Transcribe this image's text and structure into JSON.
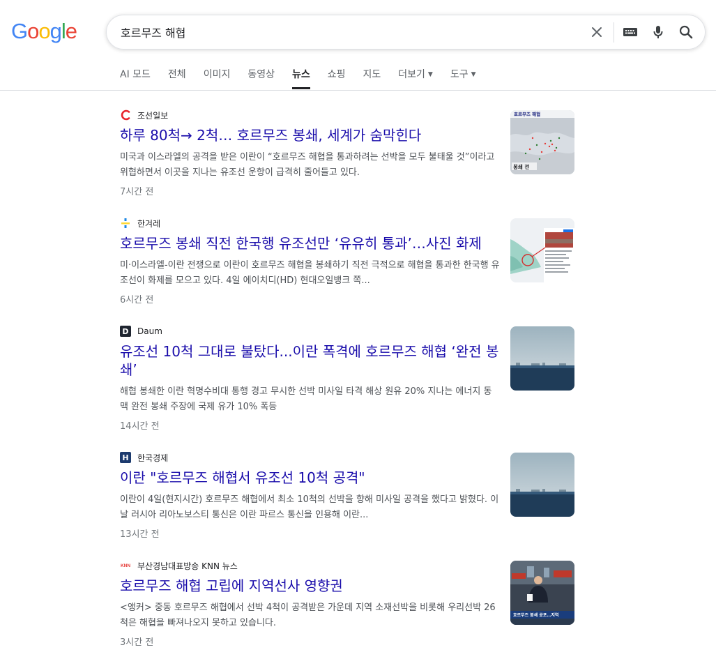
{
  "logo": {
    "g1": "G",
    "o1": "o",
    "o2": "o",
    "g2": "g",
    "l": "l",
    "e": "e"
  },
  "search": {
    "query": "호르무즈 해협"
  },
  "tabs": [
    {
      "label": "AI 모드"
    },
    {
      "label": "전체"
    },
    {
      "label": "이미지"
    },
    {
      "label": "동영상"
    },
    {
      "label": "뉴스",
      "active": true
    },
    {
      "label": "쇼핑"
    },
    {
      "label": "지도"
    },
    {
      "label": "더보기",
      "dropdown": true
    },
    {
      "label": "도구",
      "dropdown": true
    }
  ],
  "icons": {
    "clear": "close-icon",
    "keyboard": "keyboard-icon",
    "mic": "microphone-icon",
    "search": "search-icon"
  },
  "colors": {
    "link": "#1a0dab",
    "blue": "#4285f4",
    "red": "#ea4335",
    "yellow": "#fbbc05",
    "green": "#34a853"
  },
  "results": [
    {
      "source": "조선일보",
      "title": "하루 80척→ 2척… 호르무즈 봉쇄, 세계가 숨막힌다",
      "snippet": "미국과 이스라엘의 공격을 받은 이란이 “호르무즈 해협을 통과하려는 선박을 모두 불태울 것”이라고 위협하면서 이곳을 지나는 유조선 운항이 급격히 줄어들고 있다.",
      "time": "7시간 전",
      "thumb_caption": "호르무즈 해협",
      "thumb_sub": "봉쇄 전"
    },
    {
      "source": "한겨레",
      "title": "호르무즈 봉쇄 직전 한국행 유조선만 ‘유유히 통과’…사진 화제",
      "snippet": "미·이스라엘-이란 전쟁으로 이란이 호르무즈 해협을 봉쇄하기 직전 극적으로 해협을 통과한 한국행 유조선이 화제를 모으고 있다. 4일 에이치디(HD) 현대오일뱅크 쪽...",
      "time": "6시간 전"
    },
    {
      "source": "Daum",
      "title": "유조선 10척 그대로 불탔다...이란 폭격에 호르무즈 해협 ‘완전 봉쇄’",
      "snippet": "해협 봉쇄한 이란 혁명수비대 통행 경고 무시한 선박 미사일 타격 해상 원유 20% 지나는 에너지 동맥 완전 봉쇄 주장에 국제 유가 10% 폭등",
      "time": "14시간 전"
    },
    {
      "source": "한국경제",
      "title": "이란 \"호르무즈 해협서 유조선 10척 공격\"",
      "snippet": "이란이 4일(현지시간) 호르무즈 해협에서 최소 10척의 선박을 향해 미사일 공격을 했다고 밝혔다. 이날 러시아 리아노보스티 통신은 이란 파르스 통신을 인용해 이란...",
      "time": "13시간 전"
    },
    {
      "source": "부산경남대표방송 KNN 뉴스",
      "title": "호르무즈 해협 고립에 지역선사 영향권",
      "snippet": "<앵커> 중동 호르무즈 해협에서 선박 4척이 공격받은 가운데 지역 소재선박을 비롯해 우리선박 26척은 해협을 빠져나오지 못하고 있습니다.",
      "time": "3시간 전",
      "thumb_caption": "호르무즈 봉쇄 공포…지역"
    }
  ],
  "favicons": {
    "daum": "D",
    "hankyung": "H",
    "knn": "KNN"
  }
}
